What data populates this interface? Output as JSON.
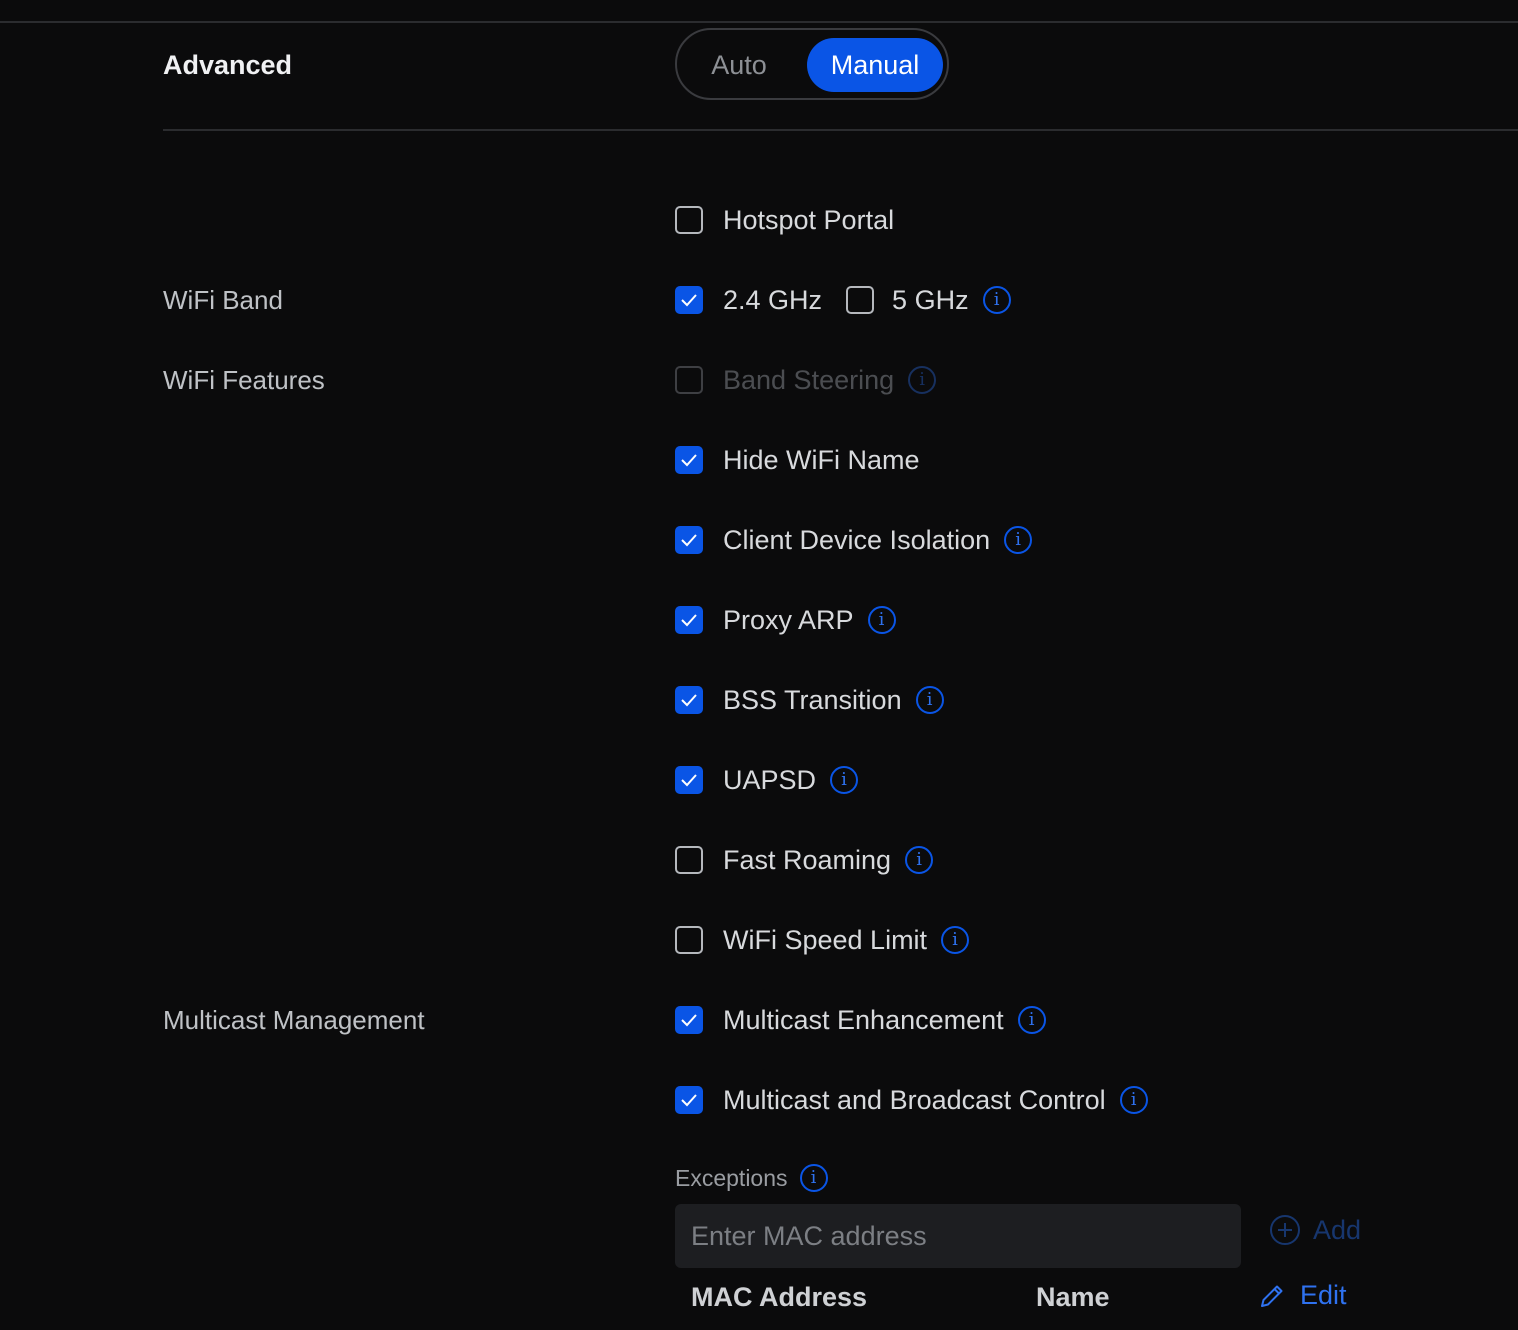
{
  "section": {
    "title": "Advanced",
    "mode_options": [
      "Auto",
      "Manual"
    ],
    "mode_selected": "Manual"
  },
  "hotspot": {
    "label": "Hotspot Portal",
    "checked": false
  },
  "wifi_band": {
    "label": "WiFi Band",
    "options": [
      {
        "label": "2.4 GHz",
        "checked": true
      },
      {
        "label": "5 GHz",
        "checked": false
      }
    ]
  },
  "wifi_features": {
    "label": "WiFi Features",
    "items": [
      {
        "label": "Band Steering",
        "checked": false,
        "disabled": true,
        "info": true
      },
      {
        "label": "Hide WiFi Name",
        "checked": true,
        "info": false
      },
      {
        "label": "Client Device Isolation",
        "checked": true,
        "info": true
      },
      {
        "label": "Proxy ARP",
        "checked": true,
        "info": true
      },
      {
        "label": "BSS Transition",
        "checked": true,
        "info": true
      },
      {
        "label": "UAPSD",
        "checked": true,
        "info": true
      },
      {
        "label": "Fast Roaming",
        "checked": false,
        "info": true
      },
      {
        "label": "WiFi Speed Limit",
        "checked": false,
        "info": true
      }
    ]
  },
  "multicast": {
    "label": "Multicast Management",
    "items": [
      {
        "label": "Multicast Enhancement",
        "checked": true,
        "info": true
      },
      {
        "label": "Multicast and Broadcast Control",
        "checked": true,
        "info": true
      }
    ],
    "exceptions_label": "Exceptions",
    "mac_input_placeholder": "Enter MAC address",
    "add_label": "Add",
    "table_headers": [
      "MAC Address",
      "Name"
    ],
    "edit_label": "Edit"
  },
  "colors": {
    "accent": "#0a55e6",
    "background": "#0b0b0c",
    "info_icon": "#2f72f0"
  },
  "icons": {
    "info": "info-icon",
    "check": "checkmark-icon",
    "add": "plus-circle-icon",
    "edit": "pencil-icon"
  }
}
